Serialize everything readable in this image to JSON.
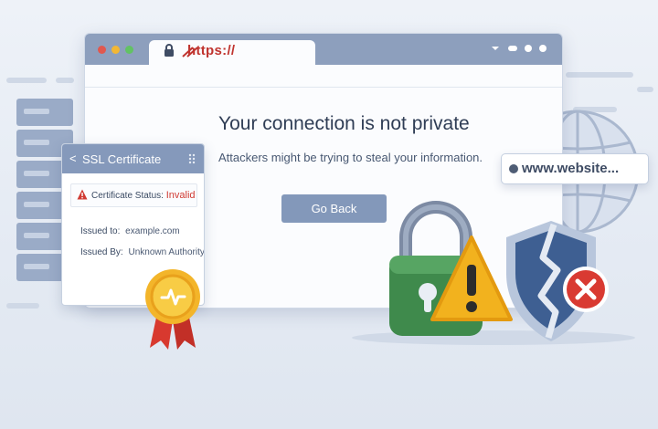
{
  "browser": {
    "address_text": "https://",
    "heading": "Your connection is not private",
    "subheading": "Attackers might be trying to steal your information.",
    "go_back_label": "Go Back"
  },
  "ssl_panel": {
    "back_glyph": "<",
    "title": "SSL Certificate",
    "status_label": "Certificate Status:",
    "status_value": "Invalid",
    "issued_to_label": "Issued to:",
    "issued_to_value": "example.com",
    "issued_by_label": "Issued By:",
    "issued_by_value": "Unknown Authority"
  },
  "url_pill": {
    "text": "www.website..."
  },
  "colors": {
    "titlebar": "#8d9fbd",
    "button": "#8398ba",
    "danger": "#d03a32",
    "warning": "#f2b21e",
    "lock_green": "#3f8a4c",
    "shield_blue": "#3e5f92"
  },
  "icons": [
    "lock-icon",
    "warning-icon",
    "broken-shield-icon",
    "error-x-icon",
    "globe-icon",
    "server-icon",
    "award-seal-icon"
  ]
}
